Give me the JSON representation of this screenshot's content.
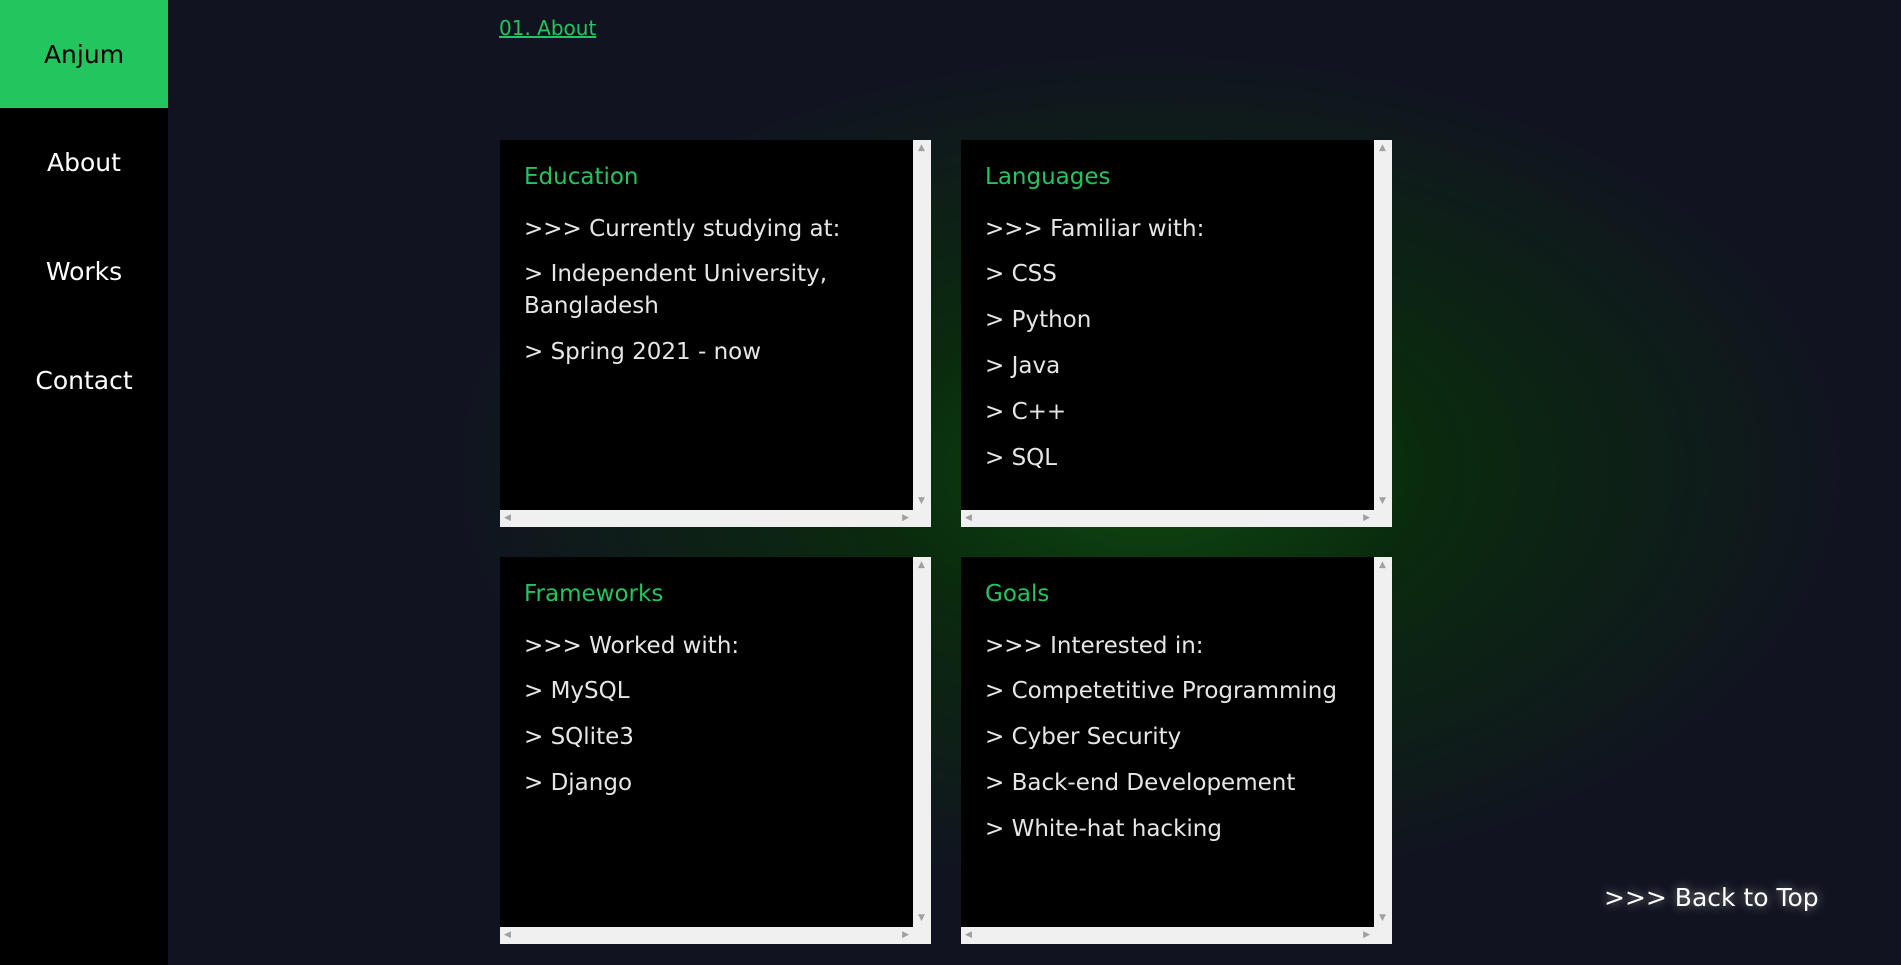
{
  "sidebar": {
    "brand": "Anjum",
    "items": [
      {
        "label": "About"
      },
      {
        "label": "Works"
      },
      {
        "label": "Contact"
      }
    ]
  },
  "section": {
    "link_label": "01. About"
  },
  "cards": [
    {
      "title": "Education",
      "lead": ">>> Currently studying at:",
      "items": [
        "> Independent University, Bangladesh",
        "> Spring 2021 - now"
      ]
    },
    {
      "title": "Languages",
      "lead": ">>> Familiar with:",
      "items": [
        "> CSS",
        "> Python",
        "> Java",
        "> C++",
        "> SQL"
      ]
    },
    {
      "title": "Frameworks",
      "lead": ">>> Worked with:",
      "items": [
        "> MySQL",
        "> SQlite3",
        "> Django"
      ]
    },
    {
      "title": "Goals",
      "lead": ">>> Interested in:",
      "items": [
        "> Competetitive Programming",
        "> Cyber Security",
        "> Back-end Developement",
        "> White-hat hacking"
      ]
    }
  ],
  "back_to_top": {
    "label": ">>> Back to Top"
  },
  "colors": {
    "accent": "#22c55e",
    "sidebar_bg": "#000000",
    "page_bg": "#121420",
    "card_bg": "#000000",
    "text": "#e6e6e6"
  },
  "icons": {
    "scroll_up": "triangle-up",
    "scroll_down": "triangle-down",
    "scroll_left": "triangle-left",
    "scroll_right": "triangle-right"
  }
}
